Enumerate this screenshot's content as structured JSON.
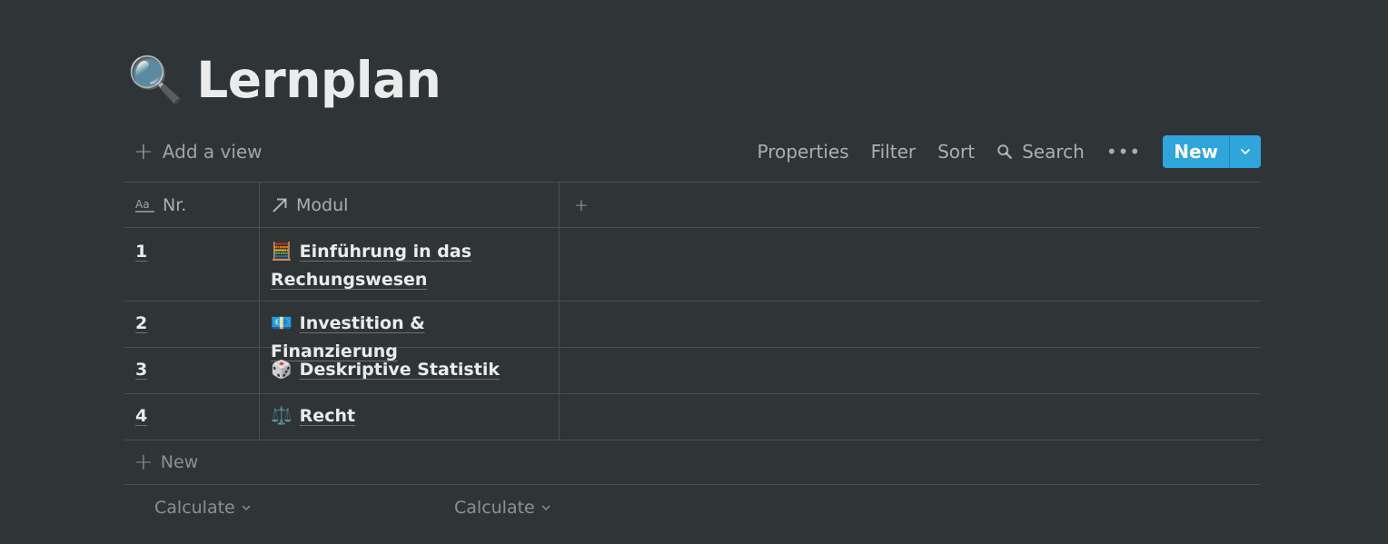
{
  "title": {
    "emoji": "🔍",
    "text": "Lernplan"
  },
  "toolbar": {
    "add_view": "Add a view",
    "properties": "Properties",
    "filter": "Filter",
    "sort": "Sort",
    "search": "Search",
    "more": "•••",
    "new": "New",
    "accent_color": "#2ea5db"
  },
  "table": {
    "columns": [
      {
        "label": "Nr.",
        "icon": "text-property-icon"
      },
      {
        "label": "Modul",
        "icon": "relation-arrow-icon"
      }
    ],
    "rows": [
      {
        "nr": "1",
        "emoji": "🧮",
        "modul": "Einführung in das Rechungswesen"
      },
      {
        "nr": "2",
        "emoji": "💶",
        "modul": "Investition & Finanzierung"
      },
      {
        "nr": "3",
        "emoji": "🎲",
        "modul": "Deskriptive Statistik"
      },
      {
        "nr": "4",
        "emoji": "⚖️",
        "modul": "Recht"
      }
    ],
    "new_row": "New",
    "calculate": [
      "Calculate",
      "Calculate"
    ]
  }
}
